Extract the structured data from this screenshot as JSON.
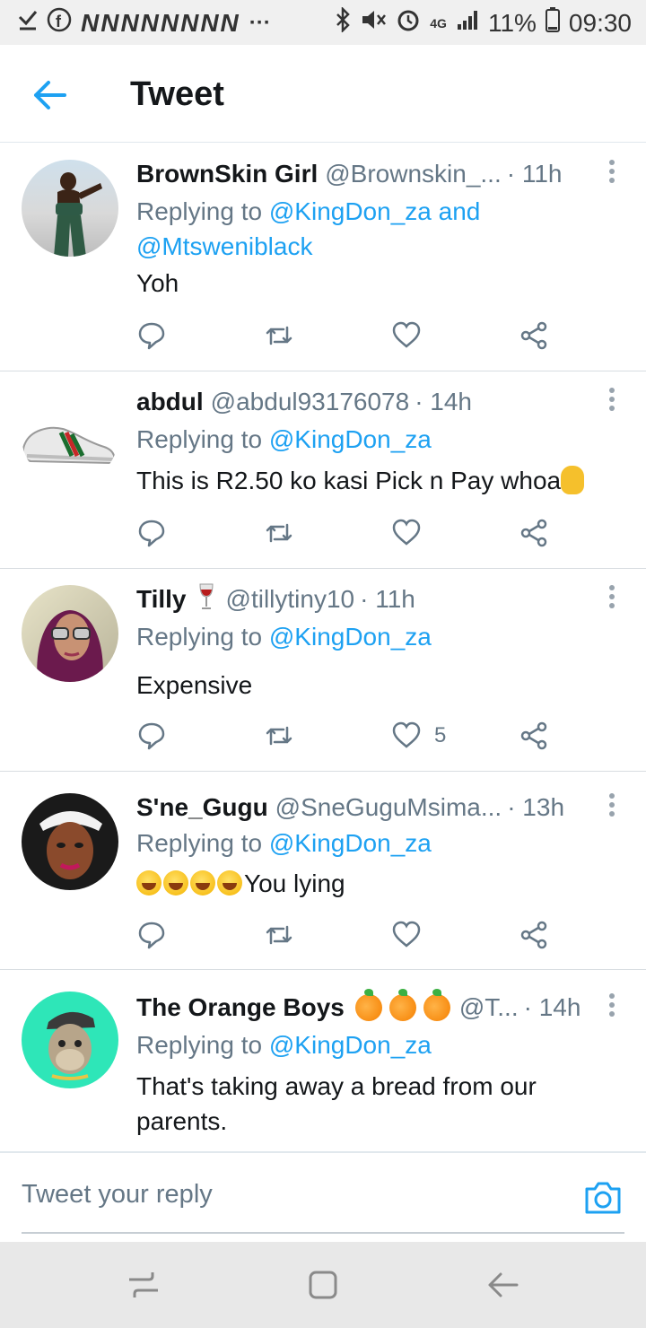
{
  "status_bar": {
    "n_icons": "NNNNNNNN",
    "overflow": "···",
    "network": "4G",
    "battery": "11%",
    "time": "09:30"
  },
  "header": {
    "title": "Tweet"
  },
  "tweets": [
    {
      "name": "BrownSkin Girl",
      "handle": "@Brownskin_...",
      "time": "· 11h",
      "replying_prefix": "Replying to ",
      "mentions": "@KingDon_za and @Mtsweniblack",
      "text": "Yoh",
      "like_count": ""
    },
    {
      "name": "abdul",
      "handle": "@abdul93176078",
      "time": "· 14h",
      "replying_prefix": "Replying to ",
      "mentions": "@KingDon_za",
      "text": "This is R2.50 ko kasi Pick n Pay whoa",
      "like_count": ""
    },
    {
      "name": "Tilly",
      "handle": "@tillytiny10",
      "time": "· 11h",
      "replying_prefix": "Replying to ",
      "mentions": "@KingDon_za",
      "text": "Expensive",
      "like_count": "5"
    },
    {
      "name": "S'ne_Gugu",
      "handle": "@SneGuguMsima...",
      "time": "· 13h",
      "replying_prefix": "Replying to ",
      "mentions": "@KingDon_za",
      "text": "You lying",
      "like_count": ""
    },
    {
      "name": "The Orange Boys",
      "handle": "@T...",
      "time": "· 14h",
      "replying_prefix": "Replying to ",
      "mentions": "@KingDon_za",
      "text": "That's taking away a bread from our parents.",
      "like_count": ""
    }
  ],
  "reply_bar": {
    "placeholder": "Tweet your reply"
  },
  "colors": {
    "accent": "#1da1f2",
    "secondary_text": "#657786",
    "primary_text": "#14171a"
  }
}
